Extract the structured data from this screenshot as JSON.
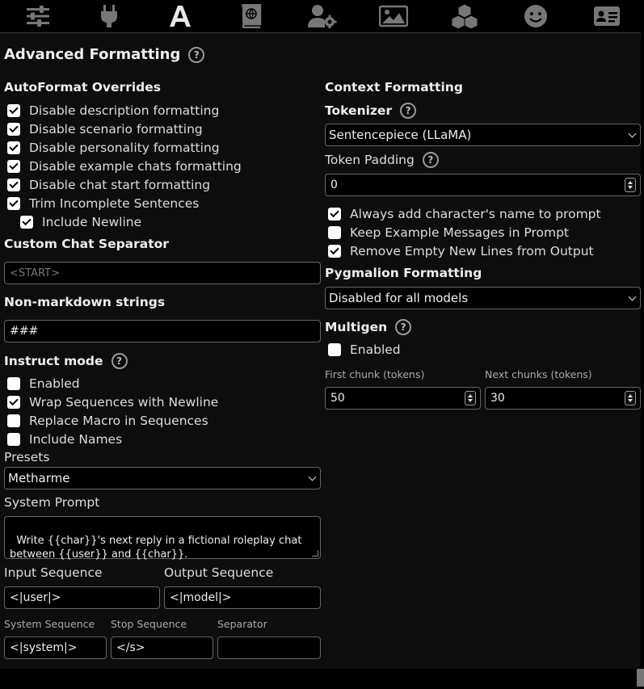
{
  "nav": {
    "tabs": [
      {
        "icon": "sliders-icon"
      },
      {
        "icon": "plug-icon"
      },
      {
        "icon": "font-a-icon"
      },
      {
        "icon": "book-globe-icon"
      },
      {
        "icon": "user-gear-icon"
      },
      {
        "icon": "image-icon"
      },
      {
        "icon": "cubes-icon"
      },
      {
        "icon": "smiley-icon"
      },
      {
        "icon": "id-card-icon"
      }
    ],
    "active_index": 2
  },
  "panel": {
    "title": "Advanced Formatting",
    "help": "?"
  },
  "autoformat": {
    "header": "AutoFormat Overrides",
    "options": [
      {
        "label": "Disable description formatting",
        "checked": true
      },
      {
        "label": "Disable scenario formatting",
        "checked": true
      },
      {
        "label": "Disable personality formatting",
        "checked": true
      },
      {
        "label": "Disable example chats formatting",
        "checked": true
      },
      {
        "label": "Disable chat start formatting",
        "checked": true
      },
      {
        "label": "Trim Incomplete Sentences",
        "checked": true
      },
      {
        "label": "Include Newline",
        "checked": true
      }
    ]
  },
  "custom_separator": {
    "header": "Custom Chat Separator",
    "placeholder": "<START>",
    "value": ""
  },
  "nonmarkdown": {
    "header": "Non-markdown strings",
    "value": "###"
  },
  "instruct": {
    "header": "Instruct mode",
    "help": "?",
    "options": [
      {
        "label": "Enabled",
        "checked": false
      },
      {
        "label": "Wrap Sequences with Newline",
        "checked": true
      },
      {
        "label": "Replace Macro in Sequences",
        "checked": false
      },
      {
        "label": "Include Names",
        "checked": false
      }
    ],
    "presets_label": "Presets",
    "preset_value": "Metharme",
    "system_prompt_label": "System Prompt",
    "system_prompt": "Write {{char}}'s next reply in a fictional roleplay chat\nbetween {{user}} and {{char}}.",
    "input_seq_label": "Input Sequence",
    "input_seq": "<|user|>",
    "output_seq_label": "Output Sequence",
    "output_seq": "<|model|>",
    "system_seq_label": "System Sequence",
    "system_seq": "<|system|>",
    "stop_seq_label": "Stop Sequence",
    "stop_seq": "</s>",
    "separator_label": "Separator",
    "separator": ""
  },
  "context": {
    "header": "Context Formatting",
    "tokenizer_label": "Tokenizer",
    "tokenizer_help": "?",
    "tokenizer_value": "Sentencepiece (LLaMA)",
    "token_padding_label": "Token Padding",
    "token_padding_help": "?",
    "token_padding_value": "0",
    "options": [
      {
        "label": "Always add character's name to prompt",
        "checked": true
      },
      {
        "label": "Keep Example Messages in Prompt",
        "checked": false
      },
      {
        "label": "Remove Empty New Lines from Output",
        "checked": true
      }
    ],
    "pygmalion_header": "Pygmalion Formatting",
    "pygmalion_value": "Disabled for all models"
  },
  "multigen": {
    "header": "Multigen",
    "help": "?",
    "enabled_label": "Enabled",
    "enabled": false,
    "first_chunk_label": "First chunk (tokens)",
    "first_chunk_value": "50",
    "next_chunks_label": "Next chunks (tokens)",
    "next_chunks_value": "30"
  },
  "colors": {
    "background": "#000000",
    "panel": "#0d0d0d",
    "text": "#dddddd",
    "border": "#666666"
  }
}
